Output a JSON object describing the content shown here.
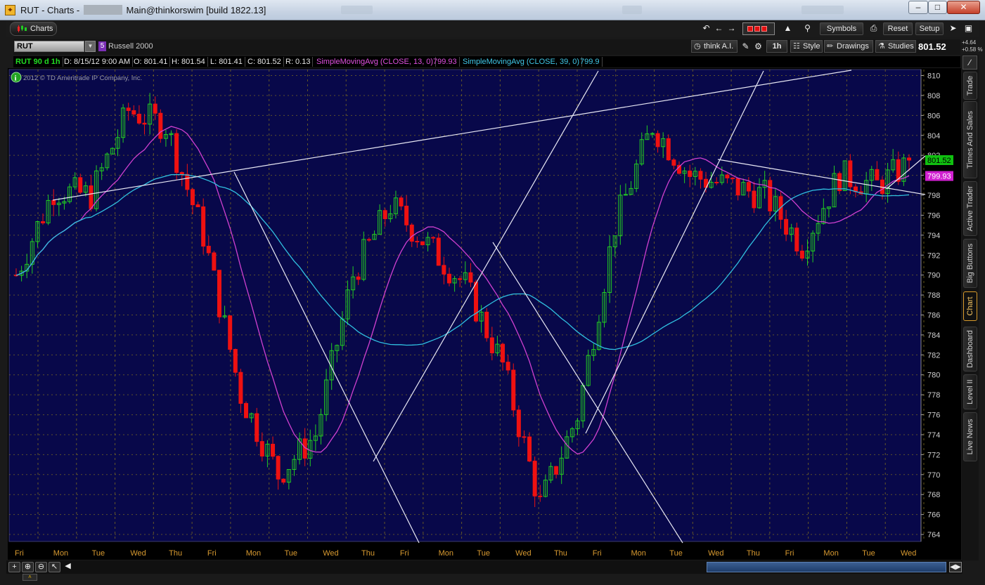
{
  "window": {
    "title_prefix": "RUT - Charts -",
    "title_suffix": "Main@thinkorswim [build 1822.13]",
    "min_label": "‒",
    "max_label": "□",
    "close_label": "✕"
  },
  "toolbar1": {
    "charts_tab": "Charts",
    "symbols": "Symbols",
    "reset": "Reset",
    "setup": "Setup"
  },
  "toolbar2": {
    "symbol": "RUT",
    "desc_badge": "5",
    "description": "Russell 2000",
    "think_ai": "think A.I.",
    "timeframe": "1h",
    "style": "Style",
    "drawings": "Drawings",
    "studies": "Studies",
    "last_price": "801.52",
    "change_abs": "+4.64",
    "change_pct": "+0.58 %"
  },
  "infobar": {
    "period": "RUT 90 d 1h",
    "date": "D: 8/15/12 9:00 AM",
    "open": "O: 801.41",
    "high": "H: 801.54",
    "low": "L: 801.41",
    "close": "C: 801.52",
    "range": "R: 0.13",
    "sma13": "SimpleMovingAvg (CLOSE, 13, 0)",
    "sma13_value": "799.93",
    "sma39": "SimpleMovingAvg (CLOSE, 39, 0)",
    "sma39_value": "799.9"
  },
  "chart": {
    "copyright": "2012 © TD Ameritrade IP Company, Inc.",
    "price_ticks": [
      "810",
      "808",
      "806",
      "804",
      "802",
      "800",
      "798",
      "796",
      "794",
      "792",
      "790",
      "788",
      "786",
      "784",
      "782",
      "780",
      "778",
      "776",
      "774",
      "772",
      "770",
      "768",
      "766",
      "764"
    ],
    "price_min": 763.3,
    "price_max": 810.6,
    "day_labels": [
      "Fri",
      "Mon",
      "Tue",
      "Wed",
      "Thu",
      "Fri",
      "Mon",
      "Tue",
      "Wed",
      "Thu",
      "Fri",
      "Mon",
      "Tue",
      "Wed",
      "Thu",
      "Fri",
      "Mon",
      "Tue",
      "Wed",
      "Thu",
      "Fri",
      "Mon",
      "Tue",
      "Wed"
    ],
    "price_label_close": "801.52",
    "price_label_sma": "799.93",
    "colors": {
      "background": "#08084a",
      "grid": "#7a6a20",
      "up": "#22cc22",
      "down": "#ee1111",
      "sma13": "#d040d0",
      "sma39": "#30c0e0",
      "trendline": "#e8e8f4"
    }
  },
  "right_tabs": [
    "Trade",
    "Times And Sales",
    "Active Trader",
    "Big Buttons",
    "Chart",
    "Dashboard",
    "Level II",
    "Live News"
  ],
  "right_tab_active": "Chart",
  "bottom": {
    "zoom_in": "+",
    "zoom_fit": "⊕",
    "zoom_out": "⊖",
    "cursor": "↖",
    "scroll_left": "◀",
    "scroll_end": "◀▶",
    "collapse": "˄"
  }
}
